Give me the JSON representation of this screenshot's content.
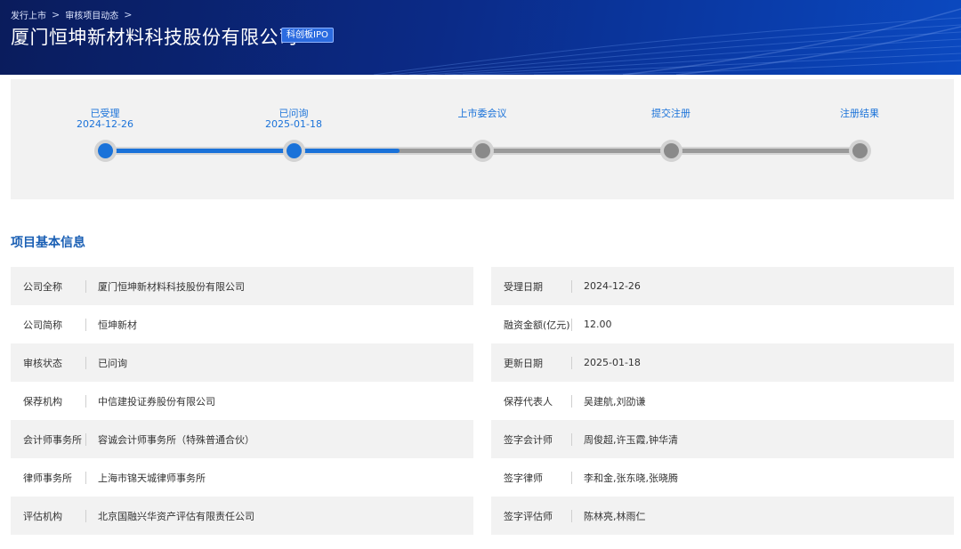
{
  "breadcrumb": {
    "items": [
      "发行上市",
      "审核项目动态"
    ],
    "separator": ">"
  },
  "header": {
    "company_name": "厦门恒坤新材料科技股份有限公司",
    "board_badge": "科创板IPO"
  },
  "progress": {
    "steps": [
      {
        "label": "已受理",
        "date": "2024-12-26",
        "status": "done"
      },
      {
        "label": "已问询",
        "date": "2025-01-18",
        "status": "done"
      },
      {
        "label": "上市委会议",
        "date": "",
        "status": "pending"
      },
      {
        "label": "提交注册",
        "date": "",
        "status": "pending"
      },
      {
        "label": "注册结果",
        "date": "",
        "status": "pending"
      }
    ],
    "fill_fraction": 0.39
  },
  "section": {
    "title": "项目基本信息"
  },
  "info": {
    "left": [
      {
        "key": "公司全称",
        "value": "厦门恒坤新材料科技股份有限公司"
      },
      {
        "key": "公司简称",
        "value": "恒坤新材"
      },
      {
        "key": "审核状态",
        "value": "已问询"
      },
      {
        "key": "保荐机构",
        "value": "中信建投证券股份有限公司"
      },
      {
        "key": "会计师事务所",
        "value": "容诚会计师事务所（特殊普通合伙）"
      },
      {
        "key": "律师事务所",
        "value": "上海市锦天城律师事务所"
      },
      {
        "key": "评估机构",
        "value": "北京国融兴华资产评估有限责任公司"
      }
    ],
    "right": [
      {
        "key": "受理日期",
        "value": "2024-12-26"
      },
      {
        "key": "融资金额(亿元)",
        "value": "12.00"
      },
      {
        "key": "更新日期",
        "value": "2025-01-18"
      },
      {
        "key": "保荐代表人",
        "value": "吴建航,刘劭谦"
      },
      {
        "key": "签字会计师",
        "value": "周俊超,许玉霞,钟华清"
      },
      {
        "key": "签字律师",
        "value": "李和金,张东晓,张晓腾"
      },
      {
        "key": "签字评估师",
        "value": "陈林亮,林雨仁"
      }
    ]
  },
  "colors": {
    "accent": "#1a72d9",
    "banner_dark": "#0a1c5c",
    "banner_light": "#0b49c0",
    "pending_node": "#8a8a8a",
    "row_shade": "#f2f2f2"
  }
}
